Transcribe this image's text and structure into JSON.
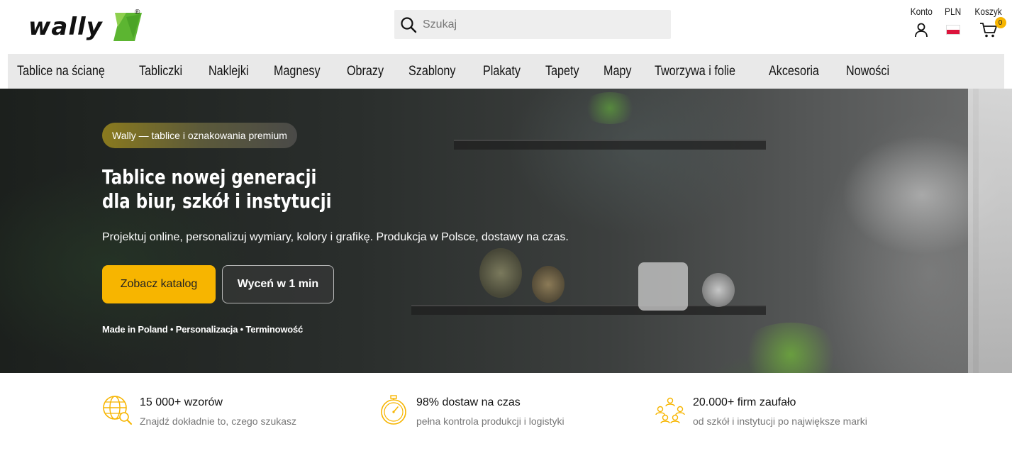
{
  "brand": {
    "logo_text": "wally",
    "logo_mark": "®"
  },
  "search": {
    "placeholder": "Szukaj"
  },
  "header_actions": {
    "account_label": "Konto",
    "currency_label": "PLN",
    "cart_label": "Koszyk",
    "cart_count": "0"
  },
  "nav": {
    "items": [
      "Tablice na ścianę",
      "Tabliczki",
      "Naklejki",
      "Magnesy",
      "Obrazy",
      "Szablony",
      "Plakaty",
      "Tapety",
      "Mapy",
      "Tworzywa i folie",
      "Akcesoria",
      "Nowości"
    ]
  },
  "hero": {
    "badge": "Wally — tablice i oznakowania premium",
    "title_line1": "Tablice nowej generacji",
    "title_line2": "dla biur, szkół i instytucji",
    "subtitle": "Projektuj online, personalizuj wymiary, kolory i grafikę. Produkcja w Polsce, dostawy na czas.",
    "primary_cta": "Zobacz katalog",
    "secondary_cta": "Wyceń w 1 min",
    "tagline": "Made in Poland • Personalizacja • Terminowość"
  },
  "features": [
    {
      "icon": "globe-search-icon",
      "title": "15 000+ wzorów",
      "desc": "Znajdź dokładnie to, czego szukasz"
    },
    {
      "icon": "stopwatch-icon",
      "title": "98% dostaw na czas",
      "desc": "pełna kontrola produkcji i logistyki"
    },
    {
      "icon": "people-network-icon",
      "title": "20.000+ firm zaufało",
      "desc": "od szkół i instytucji po największe marki"
    }
  ],
  "colors": {
    "accent": "#f7b500",
    "nav_bg": "#e9e9e9",
    "search_bg": "#eeeeee",
    "logo_green": "#5cb531"
  }
}
